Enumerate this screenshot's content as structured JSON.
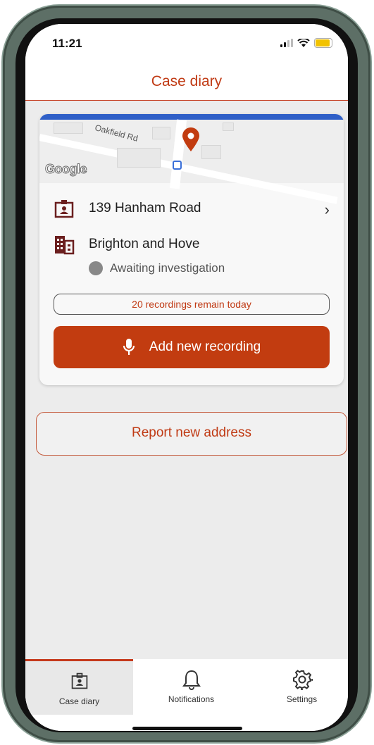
{
  "status_bar": {
    "time": "11:21"
  },
  "header": {
    "title": "Case diary"
  },
  "map": {
    "street_label": "Oakfield Rd",
    "attribution": "Google"
  },
  "case": {
    "address": "139 Hanham Road",
    "council": "Brighton and Hove",
    "status": "Awaiting investigation",
    "recordings_remaining": "20 recordings remain today",
    "add_recording_label": "Add new recording"
  },
  "report_button": {
    "label": "Report new address"
  },
  "tabs": [
    {
      "label": "Case diary",
      "icon": "id-badge-icon",
      "active": true
    },
    {
      "label": "Notifications",
      "icon": "bell-icon",
      "active": false
    },
    {
      "label": "Settings",
      "icon": "gear-icon",
      "active": false
    }
  ],
  "colors": {
    "accent": "#c23c10",
    "map_top_bar": "#2f5fc7",
    "status_dot": "#888888"
  }
}
